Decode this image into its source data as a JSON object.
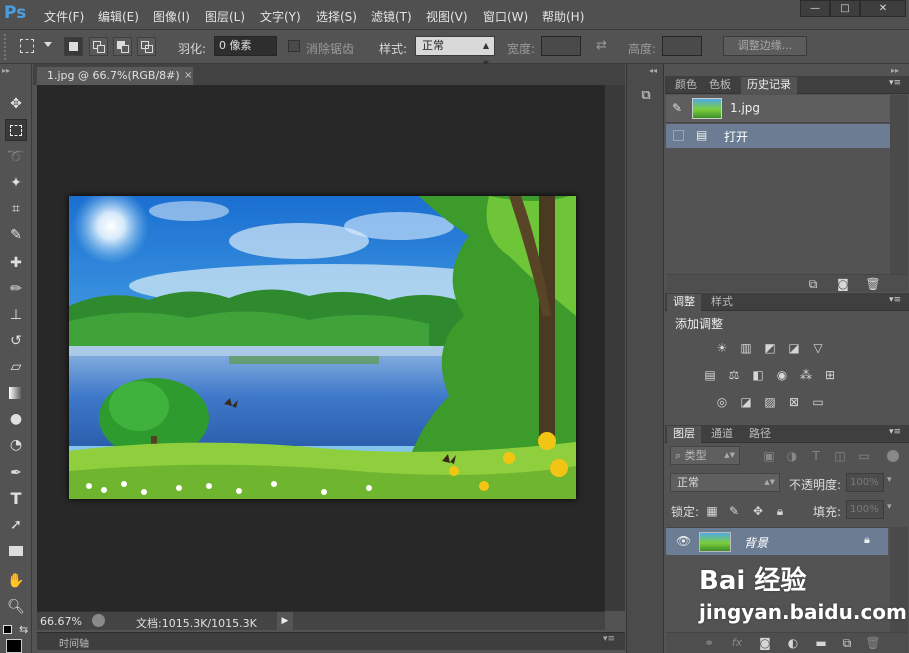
{
  "app": {
    "logo": "Ps"
  },
  "menu": [
    "文件(F)",
    "编辑(E)",
    "图像(I)",
    "图层(L)",
    "文字(Y)",
    "选择(S)",
    "滤镜(T)",
    "视图(V)",
    "窗口(W)",
    "帮助(H)"
  ],
  "window_controls": {
    "minimize": "—",
    "maximize": "□",
    "close": "✕"
  },
  "options": {
    "feather_label": "羽化:",
    "feather_value": "0 像素",
    "antialias_label": "消除锯齿",
    "style_label": "样式:",
    "style_value": "正常",
    "width_label": "宽度:",
    "height_label": "高度:",
    "refine_edge_button": "调整边缘..."
  },
  "document": {
    "tab_title": "1.jpg @ 66.7%(RGB/8#)",
    "zoom": "66.67%",
    "doc_size": "文档:1015.3K/1015.3K",
    "timeline_label": "时间轴"
  },
  "panels": {
    "top_tabs": [
      "颜色",
      "色板",
      "历史记录"
    ],
    "history": {
      "snapshot_name": "1.jpg",
      "items": [
        {
          "label": "打开"
        }
      ]
    },
    "adjust_tabs": [
      "调整",
      "样式"
    ],
    "adjust_title": "添加调整",
    "layers_tabs": [
      "图层",
      "通道",
      "路径"
    ],
    "kind_filter": "类型",
    "blend_mode": "正常",
    "opacity_label": "不透明度:",
    "opacity_value": "100%",
    "lock_label": "锁定:",
    "fill_label": "填充:",
    "fill_value": "100%",
    "layers": [
      {
        "name": "背景",
        "visible": true,
        "locked": true
      }
    ]
  },
  "watermark": {
    "brand": "Bai 经验",
    "url": "jingyan.baidu.com"
  },
  "colors": {
    "accent": "#4a9fe0",
    "selected_row": "#6b7c93",
    "panel_bg": "#535353",
    "canvas_bg": "#282828"
  }
}
